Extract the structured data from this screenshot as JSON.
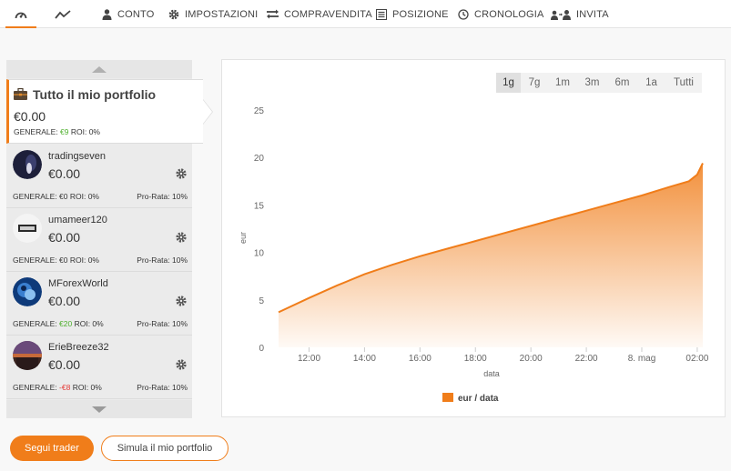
{
  "nav": {
    "items": [
      {
        "label": "",
        "icon": "dashboard-icon"
      },
      {
        "label": "",
        "icon": "trend-line-icon"
      },
      {
        "label": "CONTO",
        "icon": "user-icon"
      },
      {
        "label": "IMPOSTAZIONI",
        "icon": "gear-icon"
      },
      {
        "label": "COMPRAVENDITA",
        "icon": "exchange-icon"
      },
      {
        "label": "POSIZIONE",
        "icon": "list-icon"
      },
      {
        "label": "CRONOLOGIA",
        "icon": "clock-icon"
      },
      {
        "label": "INVITA",
        "icon": "invite-users-icon"
      }
    ],
    "accent": "#f07d1a"
  },
  "portfolio": {
    "title": "Tutto il mio portfolio",
    "value": "€0.00",
    "generale_label": "GENERALE:",
    "generale_value": "€9",
    "roi": "ROI: 0%"
  },
  "traders": [
    {
      "name": "tradingseven",
      "value": "€0.00",
      "generale_label": "GENERALE:",
      "generale_value": "€0",
      "generale_color": "#333333",
      "roi": "ROI: 0%",
      "prorata": "Pro-Rata: 10%"
    },
    {
      "name": "umameer120",
      "value": "€0.00",
      "generale_label": "GENERALE:",
      "generale_value": "€0",
      "generale_color": "#333333",
      "roi": "ROI: 0%",
      "prorata": "Pro-Rata: 10%"
    },
    {
      "name": "MForexWorld",
      "value": "€0.00",
      "generale_label": "GENERALE:",
      "generale_value": "€20",
      "generale_color": "#4caf2b",
      "roi": "ROI: 0%",
      "prorata": "Pro-Rata: 10%"
    },
    {
      "name": "ErieBreeze32",
      "value": "€0.00",
      "generale_label": "GENERALE:",
      "generale_value": "-€8",
      "generale_color": "#e53935",
      "roi": "ROI: 0%",
      "prorata": "Pro-Rata: 10%"
    }
  ],
  "ranges": [
    "1g",
    "7g",
    "1m",
    "3m",
    "6m",
    "1a",
    "Tutti"
  ],
  "active_range": "1g",
  "chart_data": {
    "type": "area",
    "xlabel": "data",
    "ylabel": "eur",
    "ylim": [
      0,
      25
    ],
    "yticks": [
      0,
      5,
      10,
      15,
      20,
      25
    ],
    "xticks": [
      "12:00",
      "14:00",
      "16:00",
      "18:00",
      "20:00",
      "22:00",
      "8. mag",
      "02:00"
    ],
    "series": [
      {
        "name": "eur / data",
        "color": "#f07d1a",
        "x_hours": [
          10.9,
          12,
          13,
          14,
          15,
          16,
          17,
          18,
          19,
          20,
          21,
          22,
          23,
          24,
          25,
          25.7,
          26.0,
          26.2
        ],
        "values": [
          3.7,
          5.2,
          6.5,
          7.7,
          8.7,
          9.6,
          10.4,
          11.2,
          12.0,
          12.8,
          13.6,
          14.4,
          15.2,
          16.0,
          16.9,
          17.5,
          18.2,
          19.4
        ]
      }
    ],
    "legend": "bottom-center"
  },
  "buttons": {
    "follow": "Segui trader",
    "simulate": "Simula il mio portfolio"
  }
}
